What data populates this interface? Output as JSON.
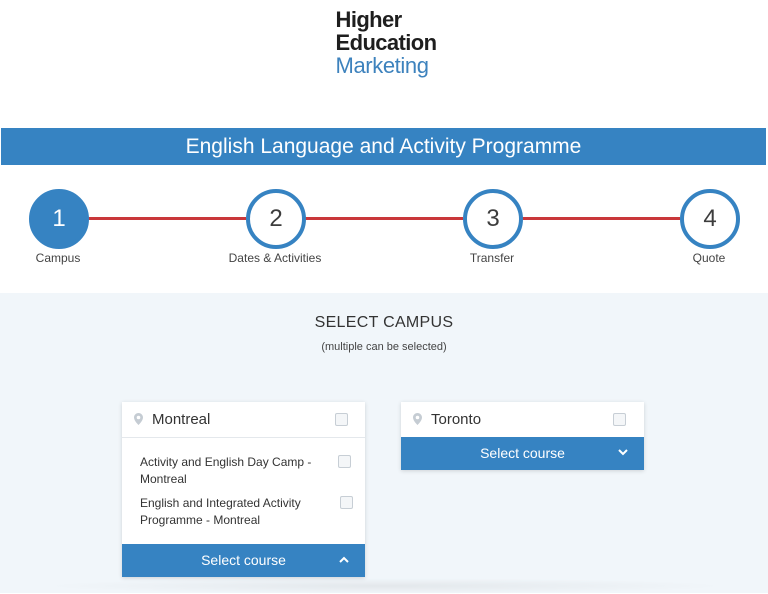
{
  "logo": {
    "line1": "Higher",
    "line2": "Education",
    "line3": "Marketing"
  },
  "banner": {
    "title": "English Language and Activity Programme"
  },
  "steps": [
    {
      "number": "1",
      "label": "Campus",
      "active": true
    },
    {
      "number": "2",
      "label": "Dates & Activities",
      "active": false
    },
    {
      "number": "3",
      "label": "Transfer",
      "active": false
    },
    {
      "number": "4",
      "label": "Quote",
      "active": false
    }
  ],
  "colors": {
    "primary": "#3683c2",
    "step_line": "#c9373a",
    "content_bg": "#f1f6fa"
  },
  "section": {
    "title": "SELECT CAMPUS",
    "subtitle": "(multiple can be selected)"
  },
  "campuses": [
    {
      "name": "Montreal",
      "icon": "map-pin-icon",
      "expanded": true,
      "courses": [
        {
          "label": "Activity and English Day Camp - Montreal"
        },
        {
          "label": "English and Integrated Activity Programme - Montreal"
        }
      ],
      "select_label": "Select course",
      "chevron": "chevron-up-icon"
    },
    {
      "name": "Toronto",
      "icon": "map-pin-icon",
      "expanded": false,
      "courses": [],
      "select_label": "Select course",
      "chevron": "chevron-down-icon"
    }
  ]
}
